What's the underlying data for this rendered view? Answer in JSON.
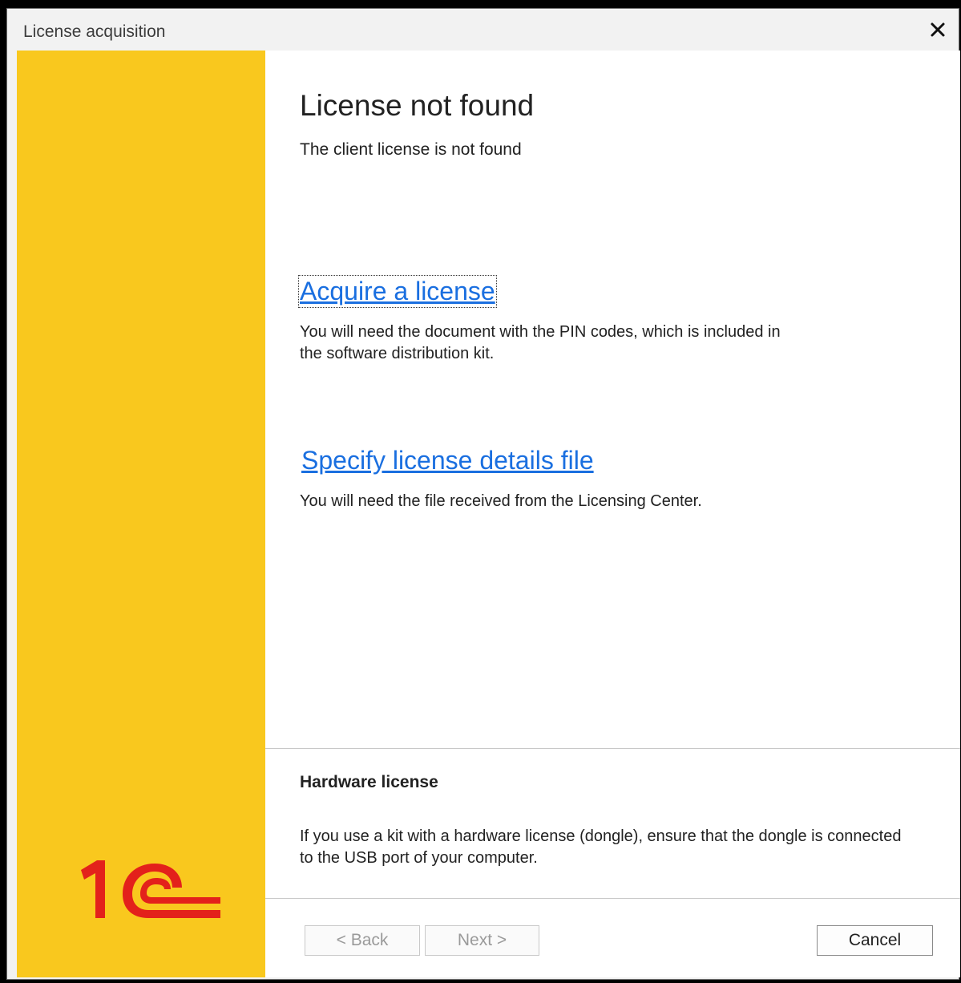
{
  "window": {
    "title": "License acquisition"
  },
  "main": {
    "heading": "License not found",
    "subheading": "The client license is not found",
    "acquire_link": "Acquire a license",
    "acquire_desc": "You will need the document with the PIN codes, which is included in the software distribution kit.",
    "specify_link": "Specify license details file",
    "specify_desc": "You will need the file received from the Licensing Center."
  },
  "hardware": {
    "title": "Hardware license",
    "desc": "If you use a kit with a hardware license (dongle), ensure that the dongle is connected to the USB port of your computer."
  },
  "footer": {
    "back_label": "< Back",
    "next_label": "Next >",
    "cancel_label": "Cancel"
  },
  "colors": {
    "sidebar": "#f9c81e",
    "logo": "#e3211b",
    "link": "#1a6fe0"
  },
  "icons": {
    "close": "close-icon",
    "logo": "1c-logo"
  }
}
